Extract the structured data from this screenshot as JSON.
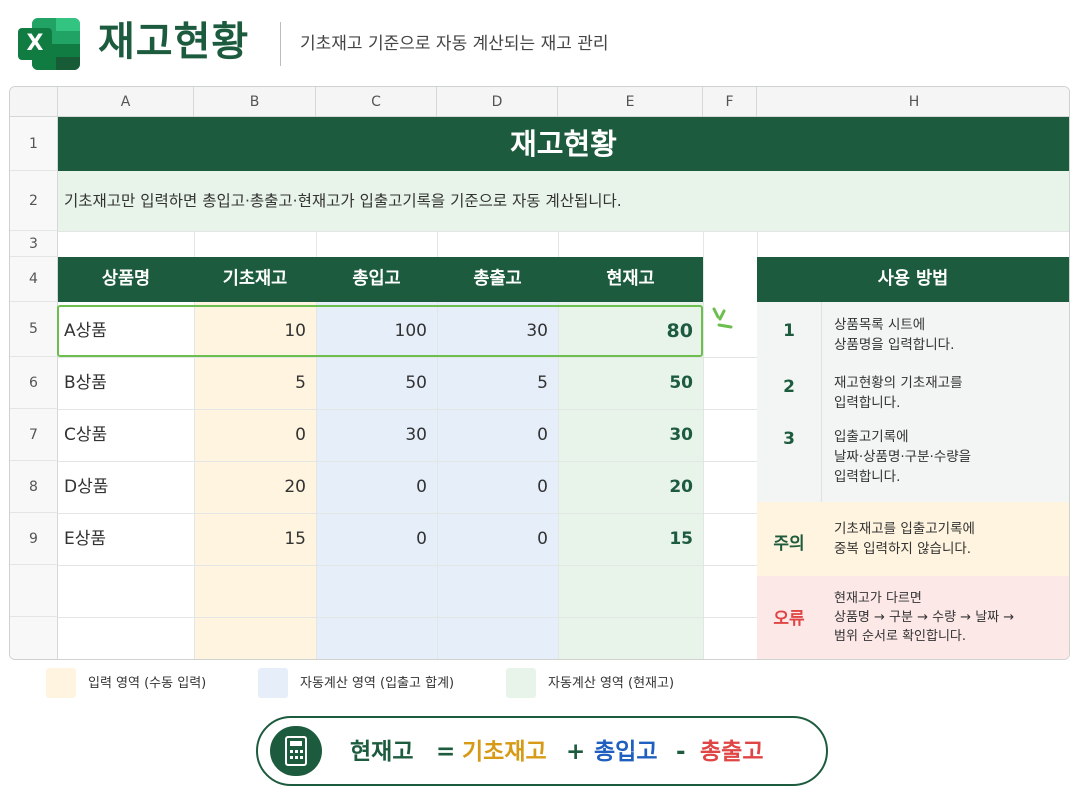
{
  "header": {
    "logo_letter": "X",
    "title": "재고현황",
    "subtitle": "기초재고 기준으로 자동 계산되는 재고 관리"
  },
  "sheet": {
    "columns": [
      "A",
      "B",
      "C",
      "D",
      "E",
      "F",
      "H"
    ],
    "rows": [
      "1",
      "2",
      "3",
      "4",
      "5",
      "6",
      "7",
      "8",
      "9"
    ],
    "banner_title": "재고현황",
    "info": "기초재고만 입력하면 총입고·총출고·현재고가 입출고기록을 기준으로 자동 계산됩니다.",
    "table": {
      "headers": [
        "상품명",
        "기초재고",
        "총입고",
        "총출고",
        "현재고"
      ],
      "rows": [
        {
          "name": "A상품",
          "base": "10",
          "in": "100",
          "out": "30",
          "current": "80"
        },
        {
          "name": "B상품",
          "base": "5",
          "in": "50",
          "out": "5",
          "current": "50"
        },
        {
          "name": "C상품",
          "base": "0",
          "in": "30",
          "out": "0",
          "current": "30"
        },
        {
          "name": "D상품",
          "base": "20",
          "in": "0",
          "out": "0",
          "current": "20"
        },
        {
          "name": "E상품",
          "base": "15",
          "in": "0",
          "out": "0",
          "current": "15"
        }
      ]
    },
    "howto": {
      "title": "사용 방법",
      "steps": [
        {
          "num": "1",
          "lines": [
            "상품목록 시트에",
            "상품명을 입력합니다."
          ]
        },
        {
          "num": "2",
          "lines": [
            "재고현황의 기초재고를",
            "입력합니다."
          ]
        },
        {
          "num": "3",
          "lines": [
            "입출고기록에",
            "날짜·상품명·구분·수량을",
            "입력합니다."
          ]
        }
      ],
      "warning": {
        "label": "주의",
        "lines": [
          "기초재고를 입출고기록에",
          "중복 입력하지 않습니다."
        ]
      },
      "error": {
        "label": "오류",
        "lines": [
          "현재고가 다르면",
          "상품명 → 구분 → 수량 → 날짜 →",
          "범위 순서로 확인합니다."
        ]
      }
    }
  },
  "legend": [
    {
      "label": "입력 영역 (수동 입력)",
      "color": "#fff4df"
    },
    {
      "label": "자동계산 영역 (입출고 합계)",
      "color": "#e6eef9"
    },
    {
      "label": "자동계산 영역 (현재고)",
      "color": "#e8f4ea"
    }
  ],
  "formula": {
    "icon": "calculator-icon",
    "result": "현재고",
    "eq": "=",
    "term1": "기초재고",
    "plus": "+",
    "term2": "총입고",
    "minus": "-",
    "term3": "총출고"
  },
  "colors": {
    "brand": "#1d5b3e",
    "input_zone": "#fff4df",
    "in_out_zone": "#e6eef9",
    "current_zone": "#e8f4ea",
    "selection": "#6cbf4e",
    "base_color": "#d79a17",
    "in_color": "#1f5fbf",
    "out_color": "#e04545"
  }
}
